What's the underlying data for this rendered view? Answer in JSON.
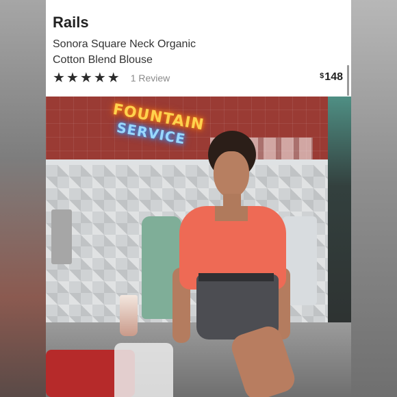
{
  "product": {
    "brand": "Rails",
    "name": "Sonora Square Neck Organic Cotton Blend Blouse",
    "rating": {
      "stars": 5,
      "max": 5,
      "review_label": "1 Review"
    },
    "price": {
      "currency": "$",
      "amount": "148"
    }
  },
  "image_text": {
    "neon_line_1": "FOUNTAIN",
    "neon_line_2": "SERVICE"
  },
  "colors": {
    "blouse": "#ee6a55",
    "star": "#2b2b2b",
    "review_text": "#8a8a8a"
  }
}
